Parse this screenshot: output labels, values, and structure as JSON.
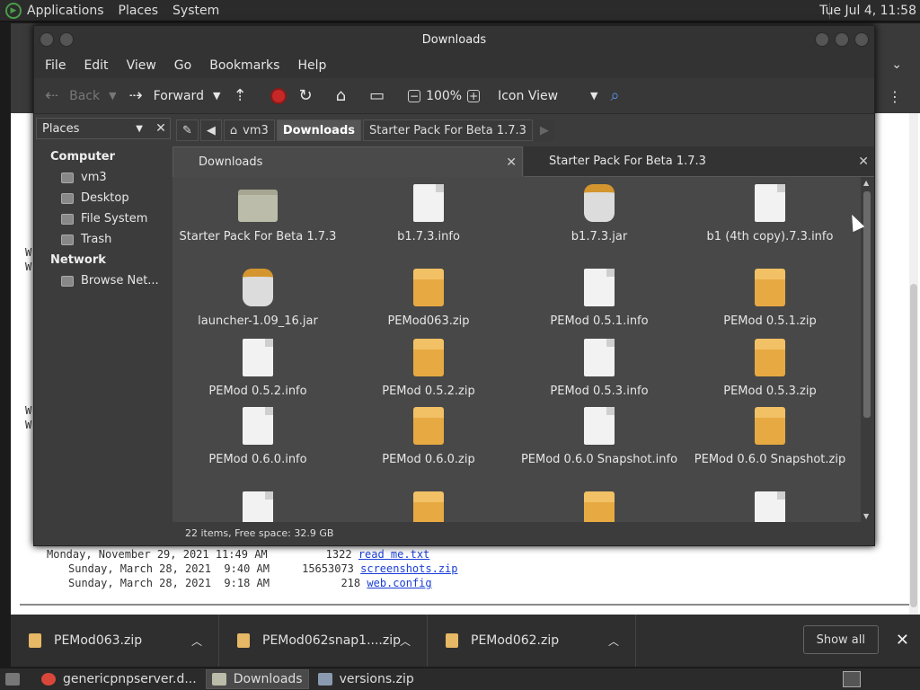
{
  "top_panel": {
    "menus": [
      "Applications",
      "Places",
      "System"
    ],
    "clock": "Tue Jul  4, 11:58"
  },
  "browser": {
    "edge_letters": [
      "W",
      "W",
      "W",
      "W"
    ],
    "dir_lines": [
      {
        "date": "Monday, November 29, 2021 11:49 AM",
        "size": "1322",
        "name": "read me.txt"
      },
      {
        "date": "Sunday, March 28, 2021  9:40 AM",
        "size": "15653073",
        "name": "screenshots.zip"
      },
      {
        "date": "Sunday, March 28, 2021  9:18 AM",
        "size": "218",
        "name": "web.config"
      }
    ]
  },
  "downloads_bar": {
    "items": [
      "PEMod063.zip",
      "PEMod062snap1....zip",
      "PEMod062.zip"
    ],
    "show_all": "Show all",
    "close": "✕"
  },
  "taskbar": {
    "tasks": [
      "genericpnpserver.d...",
      "Downloads",
      "versions.zip"
    ]
  },
  "file_manager": {
    "title": "Downloads",
    "menu": [
      "File",
      "Edit",
      "View",
      "Go",
      "Bookmarks",
      "Help"
    ],
    "toolbar": {
      "back": "Back",
      "forward": "Forward",
      "zoom": "100%",
      "view_mode": "Icon View"
    },
    "sidebar": {
      "header": "Places",
      "sections": [
        {
          "title": "Computer",
          "items": [
            "vm3",
            "Desktop",
            "File System",
            "Trash"
          ]
        },
        {
          "title": "Network",
          "items": [
            "Browse Net..."
          ]
        }
      ]
    },
    "path": [
      "vm3",
      "Downloads",
      "Starter Pack For Beta 1.7.3"
    ],
    "tabs": [
      "Downloads",
      "Starter Pack For Beta 1.7.3"
    ],
    "files": [
      {
        "name": "Starter Pack For Beta 1.7.3",
        "icon": "folder-icon"
      },
      {
        "name": "b1.7.3.info",
        "icon": "document-icon"
      },
      {
        "name": "b1.7.3.jar",
        "icon": "jar-icon"
      },
      {
        "name": "b1 (4th copy).7.3.info",
        "icon": "document-icon"
      },
      {
        "name": "launcher-1.09_16.jar",
        "icon": "jar-icon"
      },
      {
        "name": "PEMod063.zip",
        "icon": "package-icon"
      },
      {
        "name": "PEMod 0.5.1.info",
        "icon": "document-icon"
      },
      {
        "name": "PEMod 0.5.1.zip",
        "icon": "package-icon"
      },
      {
        "name": "PEMod 0.5.2.info",
        "icon": "document-icon"
      },
      {
        "name": "PEMod 0.5.2.zip",
        "icon": "package-icon"
      },
      {
        "name": "PEMod 0.5.3.info",
        "icon": "document-icon"
      },
      {
        "name": "PEMod 0.5.3.zip",
        "icon": "package-icon"
      },
      {
        "name": "PEMod 0.6.0.info",
        "icon": "document-icon"
      },
      {
        "name": "PEMod 0.6.0.zip",
        "icon": "package-icon"
      },
      {
        "name": "PEMod 0.6.0 Snapshot.info",
        "icon": "document-icon"
      },
      {
        "name": "PEMod 0.6.0 Snapshot.zip",
        "icon": "package-icon"
      },
      {
        "name": "",
        "icon": "document-icon"
      },
      {
        "name": "",
        "icon": "package-icon"
      },
      {
        "name": "",
        "icon": "package-icon"
      },
      {
        "name": "",
        "icon": "document-icon"
      }
    ],
    "status": "22 items, Free space: 32.9 GB"
  }
}
